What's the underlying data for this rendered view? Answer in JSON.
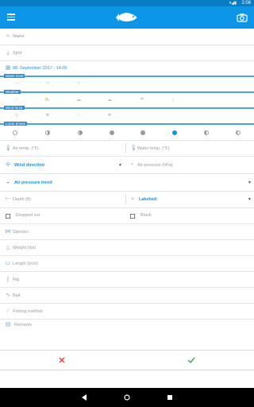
{
  "status": {
    "time": "2:08"
  },
  "form": {
    "water": "Water",
    "spot": "Spot",
    "datetime": "08. September 2017 - 14:05",
    "water_level_tag": "Water level",
    "weather_tag": "Weather",
    "wind_force_tag": "Wind force",
    "lunar_phase_tag": "Lunar phase",
    "air_temp": "Air temp. (°F)",
    "water_temp": "Water temp. (°F)",
    "wind_direction": "Wind direction",
    "air_pressure": "Air pressure (hPa)",
    "air_pressure_trend": "Air pressure trend",
    "depth": "Depth (ft)",
    "lakebed": "Lakebed",
    "dropped_out": "Dropped out",
    "blank": "Blank",
    "species": "Species",
    "weight": "Weight (lbs)",
    "length": "Length (inch)",
    "rig": "Rig",
    "bait": "Bait",
    "fishing_method": "Fishing method",
    "remarks": "Remarks"
  },
  "colors": {
    "appbar": "#0d96e8",
    "accent": "#1a8fe0",
    "cancel": "#e53935",
    "confirm": "#43a047"
  }
}
